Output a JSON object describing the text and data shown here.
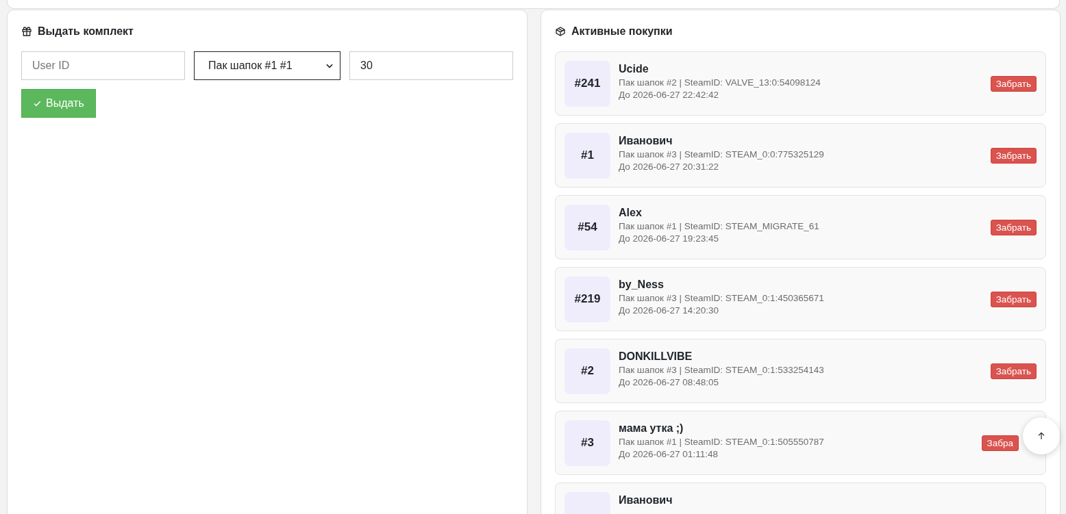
{
  "issue_panel": {
    "title": "Выдать комплект",
    "user_field": {
      "placeholder": "User ID"
    },
    "pack_select": {
      "value": "Пак шапок #1 #1"
    },
    "days_field": {
      "value": "30"
    },
    "submit_button": "Выдать"
  },
  "purchases_panel": {
    "title": "Активные покупки",
    "items": [
      {
        "number": "#241",
        "name": "Ucide",
        "details": "Пак шапок #2 | SteamID: VALVE_13:0:54098124",
        "expires": "До 2026-06-27 22:42:42",
        "action": "Забрать"
      },
      {
        "number": "#1",
        "name": "Иванович",
        "details": "Пак шапок #3 | SteamID: STEAM_0:0:775325129",
        "expires": "До 2026-06-27 20:31:22",
        "action": "Забрать"
      },
      {
        "number": "#54",
        "name": "Alex",
        "details": "Пак шапок #1 | SteamID: STEAM_MIGRATE_61",
        "expires": "До 2026-06-27 19:23:45",
        "action": "Забрать"
      },
      {
        "number": "#219",
        "name": "by_Ness",
        "details": "Пак шапок #3 | SteamID: STEAM_0:1:450365671",
        "expires": "До 2026-06-27 14:20:30",
        "action": "Забрать"
      },
      {
        "number": "#2",
        "name": "DONKILLVIBE",
        "details": "Пак шапок #3 | SteamID: STEAM_0:1:533254143",
        "expires": "До 2026-06-27 08:48:05",
        "action": "Забрать"
      },
      {
        "number": "#3",
        "name": "мама утка ;)",
        "details": "Пак шапок #1 | SteamID: STEAM_0:1:505550787",
        "expires": "До 2026-06-27 01:11:48",
        "action": "Забра",
        "covered": true
      },
      {
        "name": "Иванович"
      }
    ]
  }
}
